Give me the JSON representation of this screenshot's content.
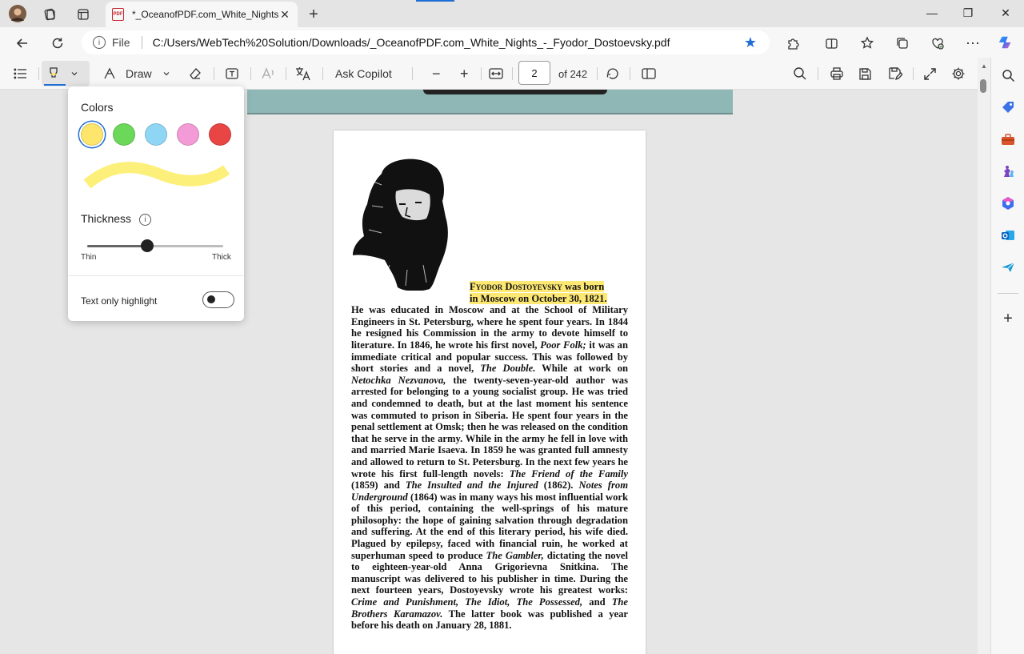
{
  "tab": {
    "title": "*_OceanofPDF.com_White_Nights_-_Fyodor_Dostoevsky.pdf",
    "close": "✕",
    "new_tab": "+"
  },
  "window": {
    "minimize": "—",
    "maximize": "❐",
    "close": "✕"
  },
  "address": {
    "info": "i",
    "scheme": "File",
    "url": "C:/Users/WebTech%20Solution/Downloads/_OceanofPDF.com_White_Nights_-_Fyodor_Dostoevsky.pdf"
  },
  "pdf_toolbar": {
    "draw_label": "Draw",
    "ask_copilot": "Ask Copilot",
    "zoom_out": "−",
    "zoom_in": "+",
    "page_current": "2",
    "page_total": "of 242"
  },
  "highlight_popup": {
    "colors_label": "Colors",
    "colors": [
      "#fde66b",
      "#6bd85a",
      "#8fd6f5",
      "#f29bd6",
      "#e84545"
    ],
    "selected_color_index": 0,
    "stroke_color": "#fdf07a",
    "thickness_label": "Thickness",
    "thickness_info": "i",
    "thickness_value": 0.44,
    "thin_label": "Thin",
    "thick_label": "Thick",
    "text_only_label": "Text only highlight",
    "text_only_on": false
  },
  "page": {
    "highlight_color": "#fde873",
    "bio_highlight_1a": "Fyodor Dostoyevsky",
    "bio_highlight_1b": " was born",
    "bio_highlight_2": "in Moscow on October 30, 1821.",
    "bio_p1": " He was educated in Moscow and at the School of Military Engineers in St. Petersburg, where he spent four years. In 1844 he resigned his Commission in the army to devote himself to literature. In 1846, he wrote his first novel, ",
    "poor_folk": "Poor Folk;",
    "bio_p2": " it was an immediate critical and popular success. This was followed by short stories and a novel, ",
    "the_double": "The Double.",
    "bio_p3": " While at work on ",
    "netochka": "Netochka Nezvanova,",
    "bio_p4": " the twenty-seven-year-old author was arrested for belonging to a young socialist group. He was tried and condemned to death, but at the last moment his sentence was commuted to prison in Siberia. He spent four years in the penal settlement at Omsk; then he was released on the condition that he serve in the army. While in the army he fell in love with and married Marie Isaeva. In 1859 he was granted full amnesty and allowed to return to St. Petersburg. In the next few years he wrote his first full-length novels: ",
    "friend_family": "The Friend of the Family",
    "bio_p5": " (1859) and ",
    "insulted": "The Insulted and the Injured",
    "bio_p6": " (1862). ",
    "notes": "Notes from Underground",
    "bio_p7": " (1864) was in many ways his most influential work of this period, containing the well-springs of his mature philosophy: the hope of gaining salvation through degradation and suffering. At the end of this literary period, his wife died. Plagued by epilepsy, faced with financial ruin, he worked at superhuman speed to produce ",
    "gambler": "The Gambler,",
    "bio_p8": " dictating the novel to eighteen-year-old Anna Grigorievna Snitkina. The manuscript was delivered to his publisher in time. During the next fourteen years, Dostoyevsky wrote his greatest works: ",
    "crime": "Crime and Punishment, The Idiot, The Possessed,",
    "bio_p9": " and ",
    "brothers": "The Brothers Karamazov.",
    "bio_p10": " The latter book was published a year before his death on January 28, 1881."
  },
  "sidebar": {
    "add": "+"
  }
}
